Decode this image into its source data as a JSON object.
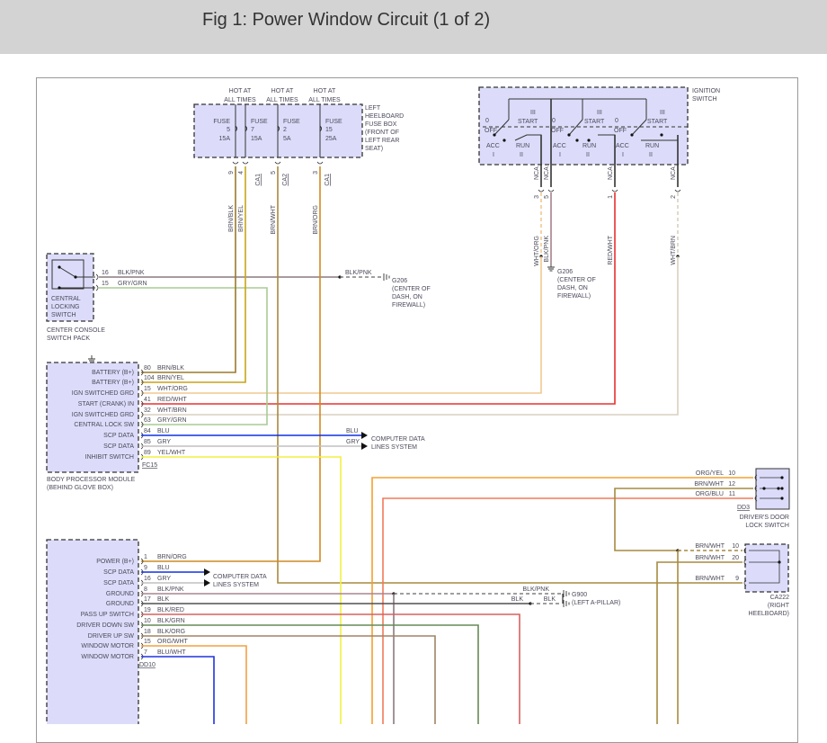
{
  "header": {
    "title": "Fig 1: Power Window Circuit (1 of 2)"
  },
  "fuse_box": {
    "title": [
      "LEFT",
      "HEELBOARD",
      "FUSE BOX",
      "(FRONT OF",
      "LEFT REAR",
      "SEAT)"
    ],
    "hot_labels": [
      [
        "HOT AT",
        "ALL TIMES"
      ],
      [
        "HOT AT",
        "ALL TIMES"
      ],
      [
        "HOT AT",
        "ALL TIMES"
      ]
    ],
    "fuses": [
      {
        "name": "FUSE",
        "number": "5",
        "rating": "15A"
      },
      {
        "name": "FUSE",
        "number": "7",
        "rating": "15A"
      },
      {
        "name": "FUSE",
        "number": "2",
        "rating": "5A"
      },
      {
        "name": "FUSE",
        "number": "15",
        "rating": "25A"
      }
    ],
    "wires": [
      {
        "pin": "9",
        "color": "BRN/BLK"
      },
      {
        "pin": "4",
        "color": "BRN/YEL"
      },
      {
        "pin": "5",
        "color": "BRN/WHT"
      },
      {
        "pin": "3",
        "color": "BRN/ORG"
      }
    ],
    "connectors": [
      "CA1",
      "CA2",
      "CA1"
    ]
  },
  "ignition_switch": {
    "title": [
      "IGNITION",
      "SWITCH"
    ],
    "sections": [
      {
        "off_num": "0",
        "off": "OFF",
        "start_num": "III",
        "start": "START",
        "acc": "ACC",
        "acc_num": "I",
        "run": "RUN",
        "run_num": "II"
      },
      {
        "off_num": "0",
        "off": "OFF",
        "start_num": "III",
        "start": "START",
        "acc": "ACC",
        "acc_num": "I",
        "run": "RUN",
        "run_num": "II"
      },
      {
        "off_num": "0",
        "off": "OFF",
        "start_num": "III",
        "start": "START",
        "acc": "ACC",
        "acc_num": "I",
        "run": "RUN",
        "run_num": "II"
      }
    ],
    "wires": [
      {
        "conn": "NCA",
        "pin": "3",
        "color": "WHT/ORG"
      },
      {
        "conn": "NCA",
        "pin": "5",
        "color": "BLK/PNK"
      },
      {
        "conn": "NCA",
        "pin": "1",
        "color": "RED/WHT"
      },
      {
        "conn": "NCA",
        "pin": "2",
        "color": "WHT/BRN"
      }
    ]
  },
  "grounds": {
    "g206_a": [
      "G206",
      "(CENTER OF",
      "DASH, ON",
      "FIREWALL)"
    ],
    "g206_b": [
      "G206",
      "(CENTER OF",
      "DASH, ON",
      "FIREWALL)"
    ],
    "g900": [
      "G900",
      "(LEFT A-PILLAR)"
    ]
  },
  "console_switch": {
    "box_label": [
      "CENTRAL",
      "LOCKING",
      "SWITCH"
    ],
    "caption": [
      "CENTER CONSOLE",
      "SWITCH PACK"
    ],
    "pins": [
      {
        "pin": "16",
        "color": "BLK/PNK"
      },
      {
        "pin": "15",
        "color": "GRY/GRN"
      }
    ],
    "ground_wire": "BLK/PNK"
  },
  "body_processor_module": {
    "caption": [
      "BODY PROCESSOR MODULE",
      "(BEHIND GLOVE BOX)"
    ],
    "connector": "FC15",
    "pins": [
      {
        "label": "BATTERY (B+)",
        "pin": "80",
        "color": "BRN/BLK"
      },
      {
        "label": "BATTERY (B+)",
        "pin": "104",
        "color": "BRN/YEL"
      },
      {
        "label": "IGN SWITCHED GRD",
        "pin": "15",
        "color": "WHT/ORG"
      },
      {
        "label": "START (CRANK) IN",
        "pin": "41",
        "color": "RED/WHT"
      },
      {
        "label": "IGN SWITCHED GRD",
        "pin": "32",
        "color": "WHT/BRN"
      },
      {
        "label": "CENTRAL LOCK SW",
        "pin": "63",
        "color": "GRY/GRN"
      },
      {
        "label": "SCP DATA",
        "pin": "84",
        "color": "BLU"
      },
      {
        "label": "SCP DATA",
        "pin": "85",
        "color": "GRY"
      },
      {
        "label": "INHIBIT SWITCH",
        "pin": "89",
        "color": "YEL/WHT"
      }
    ],
    "data_wire_labels": [
      "BLU",
      "GRY"
    ],
    "data_destination": [
      "COMPUTER DATA",
      "LINES SYSTEM"
    ]
  },
  "window_module": {
    "connector": "DD10",
    "pins": [
      {
        "label": "POWER (B+)",
        "pin": "1",
        "color": "BRN/ORG"
      },
      {
        "label": "SCP DATA",
        "pin": "9",
        "color": "BLU"
      },
      {
        "label": "SCP DATA",
        "pin": "16",
        "color": "GRY"
      },
      {
        "label": "GROUND",
        "pin": "8",
        "color": "BLK/PNK"
      },
      {
        "label": "GROUND",
        "pin": "17",
        "color": "BLK"
      },
      {
        "label": "PASS UP SWITCH",
        "pin": "19",
        "color": "BLK/RED"
      },
      {
        "label": "DRIVER DOWN SW",
        "pin": "10",
        "color": "BLK/GRN"
      },
      {
        "label": "DRIVER UP SW",
        "pin": "18",
        "color": "BLK/ORG"
      },
      {
        "label": "WINDOW MOTOR",
        "pin": "15",
        "color": "ORG/WHT"
      },
      {
        "label": "WINDOW MOTOR",
        "pin": "7",
        "color": "BLU/WHT"
      }
    ],
    "data_destination": [
      "COMPUTER DATA",
      "LINES SYSTEM"
    ],
    "ground_labels": [
      "BLK/PNK",
      "BLK",
      "BLK"
    ]
  },
  "door_lock_switch": {
    "caption": [
      "DRIVER'S DOOR",
      "LOCK SWITCH"
    ],
    "connector": "DD3",
    "pins": [
      {
        "pin": "10",
        "color": "ORG/YEL"
      },
      {
        "pin": "12",
        "color": "BRN/WHT"
      },
      {
        "pin": "11",
        "color": "ORG/BLU"
      }
    ]
  },
  "ca222": {
    "caption": [
      "CA222",
      "(RIGHT",
      "HEELBOARD)"
    ],
    "pins": [
      {
        "pin": "10",
        "color": "BRN/WHT"
      },
      {
        "pin": "20",
        "color": "BRN/WHT"
      },
      {
        "pin": "9",
        "color": "BRN/WHT"
      }
    ]
  },
  "wire_colors": {
    "BRN/BLK": "#9a7a2a",
    "BRN/YEL": "#c8a418",
    "BRN/WHT": "#a68a40",
    "BRN/ORG": "#d08a22",
    "GRY/GRN": "#a9cc94",
    "BLK/PNK": "#8a7a80",
    "WHT/ORG": "#f2c890",
    "RED/WHT": "#e83030",
    "WHT/BRN": "#d8d0c0",
    "BLU": "#1030e0",
    "GRY": "#c0c0c0",
    "YEL/WHT": "#f2f040",
    "ORG/YEL": "#f3a030",
    "ORG/BLU": "#f07a5a",
    "BLK": "#505050",
    "BLK/RED": "#d86060",
    "BLK/GRN": "#668a58",
    "BLK/ORG": "#a08464",
    "ORG/WHT": "#f3a040",
    "BLU/WHT": "#2034e0"
  },
  "component_fill": "#dcdcfa"
}
